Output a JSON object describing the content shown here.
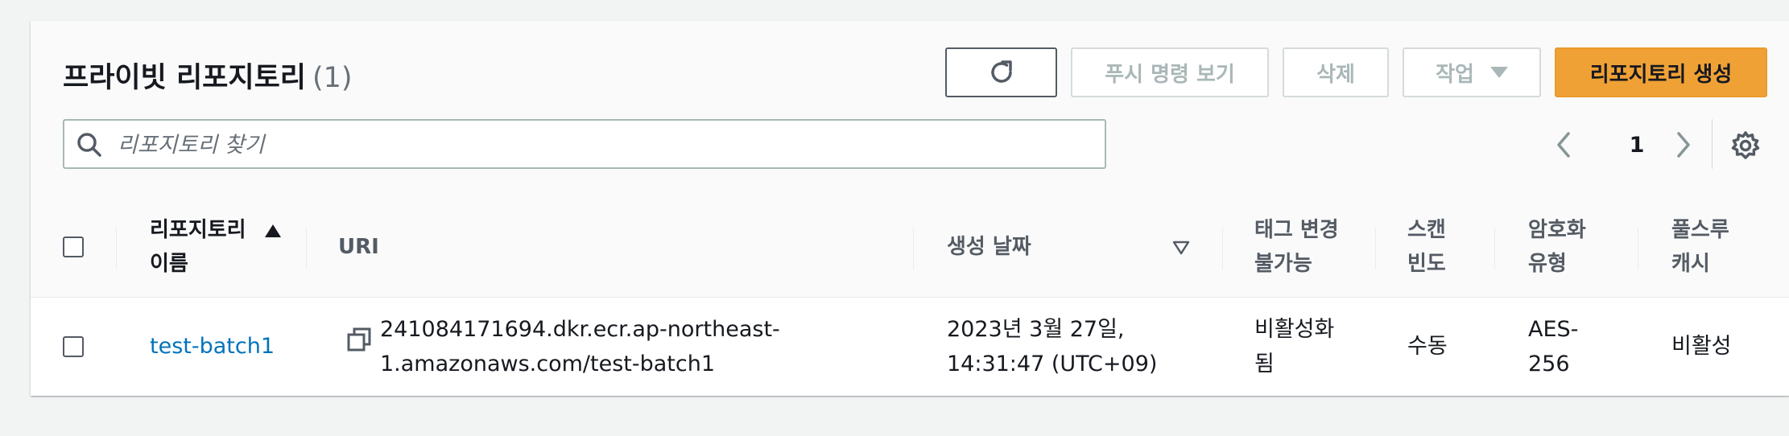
{
  "header": {
    "title": "프라이빗 리포지토리",
    "count": "(1)"
  },
  "toolbar": {
    "push_commands_label": "푸시 명령 보기",
    "delete_label": "삭제",
    "actions_label": "작업",
    "create_label": "리포지토리 생성"
  },
  "search": {
    "placeholder": "리포지토리 찾기",
    "value": ""
  },
  "pagination": {
    "current_page": "1"
  },
  "columns": {
    "name": [
      "리포지토리",
      "이름"
    ],
    "uri": "URI",
    "created": "생성 날짜",
    "immutability": [
      "태그 변경",
      "불가능"
    ],
    "scan": [
      "스캔",
      "빈도"
    ],
    "encryption": [
      "암호화",
      "유형"
    ],
    "pull_through": [
      "풀스루",
      "캐시"
    ]
  },
  "rows": [
    {
      "name": "test-batch1",
      "uri": [
        "241084171694.dkr.ecr.ap-northeast-",
        "1.amazonaws.com/test-batch1"
      ],
      "created": [
        "2023년 3월 27일,",
        "14:31:47 (UTC+09)"
      ],
      "immutability": [
        "비활성화",
        "됨"
      ],
      "scan": "수동",
      "encryption": [
        "AES-",
        "256"
      ],
      "pull_through": "비활성"
    }
  ],
  "icons": {
    "refresh": "refresh-icon",
    "search": "search-icon",
    "prev": "chevron-left-icon",
    "next": "chevron-right-icon",
    "settings": "gear-icon",
    "copy": "copy-icon",
    "sort_asc": "sort-ascending-icon",
    "sort_desc": "sort-descending-icon",
    "dropdown": "caret-down-icon"
  },
  "colors": {
    "primary_button": "#f0a136",
    "link": "#0073bb",
    "page_background": "#f2f3f3"
  }
}
